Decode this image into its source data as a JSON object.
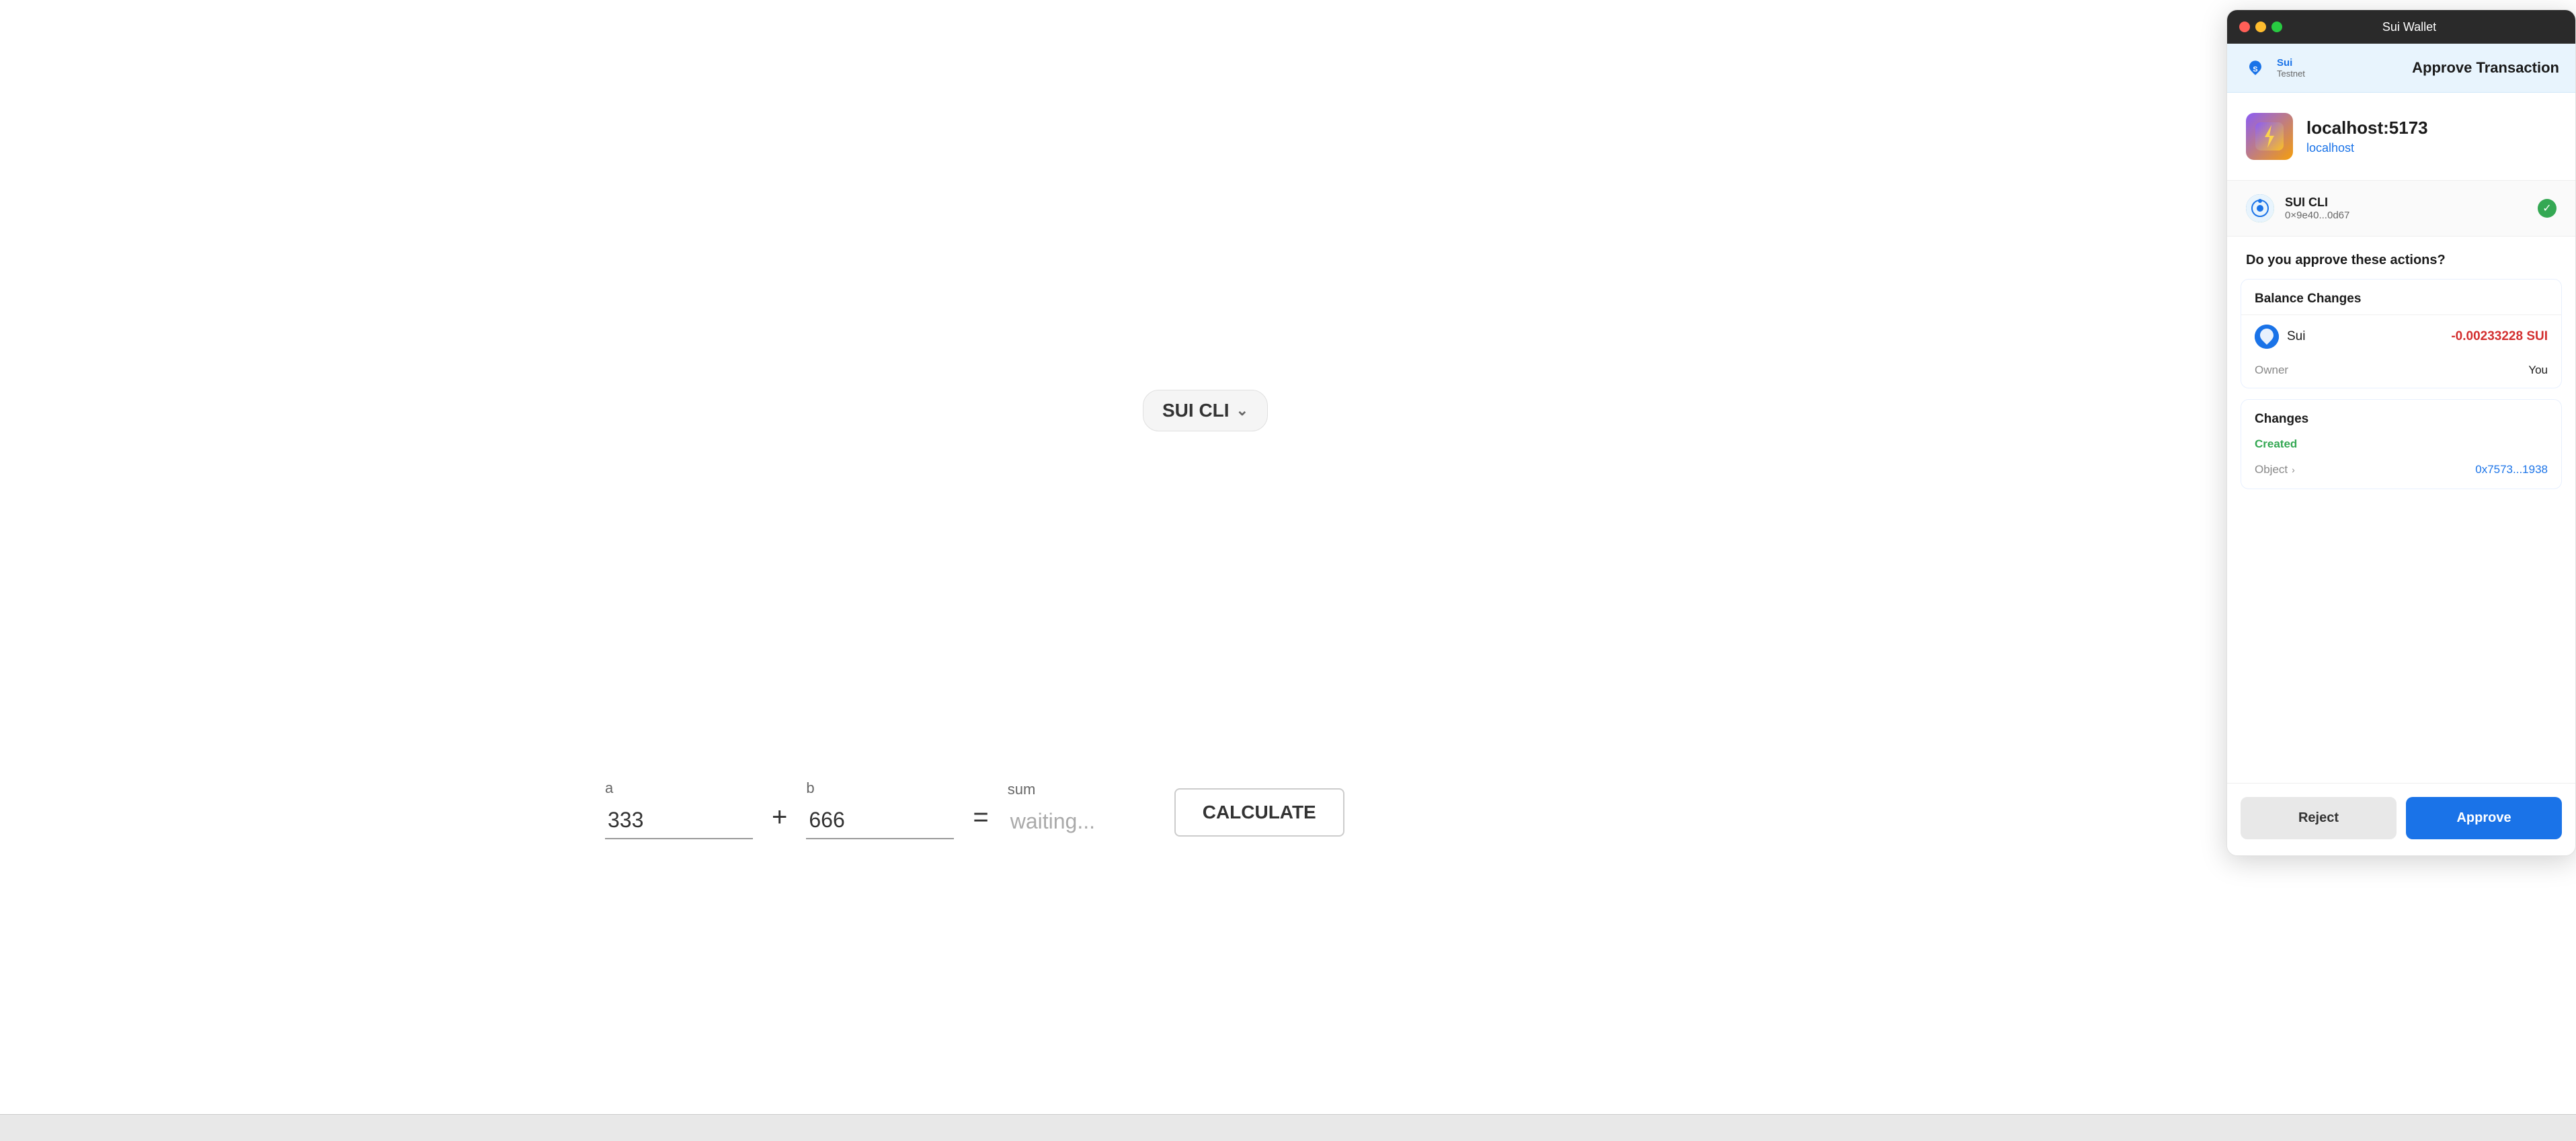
{
  "titleBar": {
    "title": "Sui Wallet",
    "dots": [
      "red",
      "yellow",
      "green"
    ]
  },
  "walletHeader": {
    "network": "Sui",
    "networkSub": "Testnet",
    "title": "Approve Transaction"
  },
  "siteInfo": {
    "name": "localhost:5173",
    "url": "localhost"
  },
  "account": {
    "name": "SUI CLI",
    "address": "0×9e40...0d67"
  },
  "approveQuestion": "Do you approve these actions?",
  "balanceChanges": {
    "header": "Balance Changes",
    "coin": "Sui",
    "amount": "-0.00233228 SUI",
    "ownerLabel": "Owner",
    "ownerValue": "You"
  },
  "changes": {
    "header": "Changes",
    "createdLabel": "Created",
    "objectLabel": "Object",
    "objectArrow": "›",
    "objectValue": "0x7573...1938"
  },
  "footer": {
    "rejectLabel": "Reject",
    "approveLabel": "Approve"
  },
  "mainApp": {
    "walletButtonLabel": "SUI CLI",
    "walletButtonChevron": "⌄"
  },
  "calculator": {
    "aLabel": "a",
    "bLabel": "b",
    "sumLabel": "sum",
    "aValue": "333",
    "bValue": "666",
    "sumPlaceholder": "waiting...",
    "plusOperator": "+",
    "equalsOperator": "=",
    "calculateLabel": "CALCULATE"
  }
}
